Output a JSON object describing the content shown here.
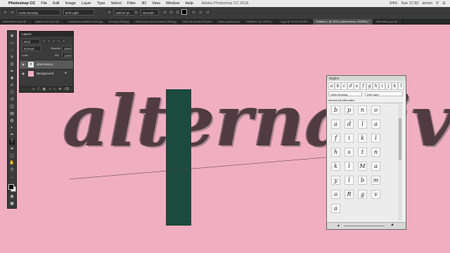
{
  "menubar": {
    "apple": "",
    "app": "Photoshop CC",
    "items": [
      "File",
      "Edit",
      "Image",
      "Layer",
      "Type",
      "Select",
      "Filter",
      "3D",
      "View",
      "Window",
      "Help"
    ],
    "window_title": "Adobe Photoshop CC 2018",
    "clock": "Sun 17:32",
    "user": "simon",
    "battery": "64%"
  },
  "options": {
    "font_family": "Hello Monday",
    "font_style": "Drill Light",
    "font_size": "208.67 pt",
    "anti_alias": "Smooth"
  },
  "tabs": [
    "alternatives.psd @ ...",
    "pattern-013.psd @ ...",
    "ornamen-variations-004.jpg",
    "monkey-006.jpg",
    "when-love-came-to-town-009.jpg",
    "hold-the-world-003.psd",
    "music-quotes.psd",
    "Untitled-1 @ 100% (...",
    "2.jpg @ 33.3% (RGB/...",
    "Untitled-1 @ 300% (alternatives, RGB/8*) *",
    "alternates.psd @ ..."
  ],
  "active_tab_index": 9,
  "layers_panel": {
    "title": "Layers",
    "kind": "Kind",
    "blend": "Normal",
    "opacity_label": "Opacity:",
    "opacity": "100%",
    "lock_label": "Lock:",
    "fill_label": "Fill:",
    "fill": "100%",
    "layers": [
      {
        "name": "alternatives",
        "thumb": "T"
      },
      {
        "name": "Background",
        "thumb": ""
      }
    ]
  },
  "canvas": {
    "lettering": "alternativ",
    "background_color": "#f0aec2",
    "swatch_color": "#1c4a3c"
  },
  "glyphs_panel": {
    "title": "Glyphs",
    "font_family": "Hello Monday",
    "font_style": "Drill Light",
    "filter": "Access All Alternates",
    "recent": [
      "a",
      "b",
      "c",
      "d",
      "e",
      "f",
      "g",
      "h",
      "i",
      "j",
      "k",
      "l"
    ],
    "grid": [
      [
        "b",
        "p",
        "n",
        "o"
      ],
      [
        "a",
        "d",
        "l",
        "a"
      ],
      [
        "f",
        "i",
        "k",
        "l"
      ],
      [
        "h",
        "s",
        "t",
        "n"
      ],
      [
        "k",
        "l",
        "M",
        "a"
      ],
      [
        "y",
        "l",
        "b",
        "m"
      ],
      [
        "o",
        "R",
        "g",
        "v"
      ],
      [
        "a",
        "",
        "",
        ""
      ]
    ]
  }
}
